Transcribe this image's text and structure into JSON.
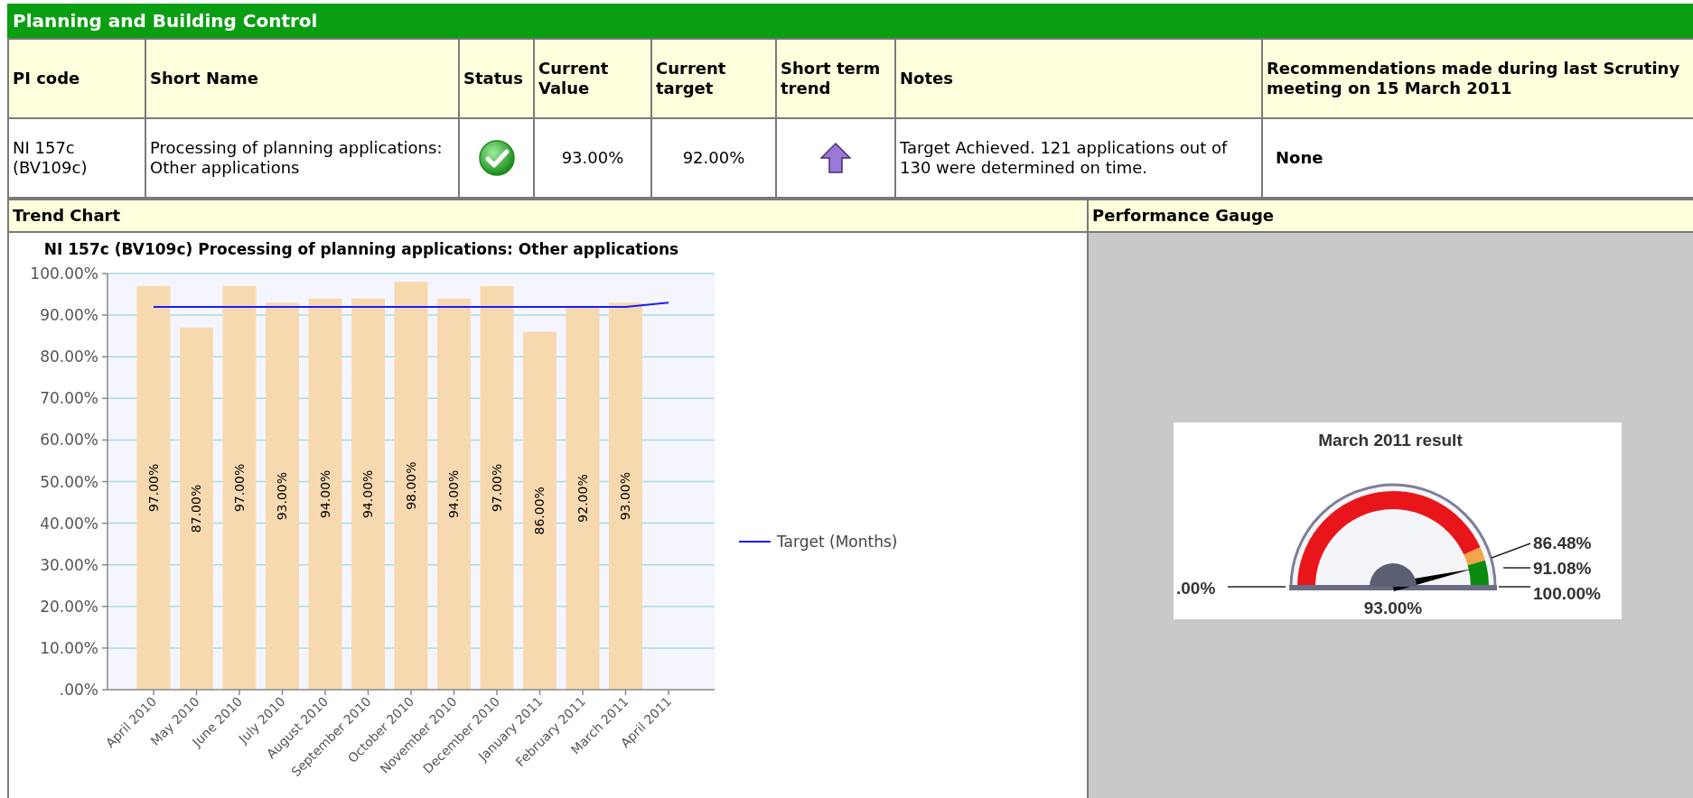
{
  "section": {
    "title": "Planning and Building Control"
  },
  "columns": [
    "PI code",
    "Short Name",
    "Status",
    "Current Value",
    "Current target",
    "Short term trend",
    "Notes",
    "Recommendations made during last Scrutiny meeting on 15 March 2011"
  ],
  "rows": [
    {
      "pi_code": "NI 157c (BV109c)",
      "short_name": "Processing of planning applications: Other applications",
      "target_met": true,
      "current_value": "93.00%",
      "current_target": "92.00%",
      "improving": true,
      "notes": "Target Achieved. 121 applications out of 130 were determined on time.",
      "recommendations": "None"
    }
  ],
  "trend_chart": {
    "heading": "Trend Chart",
    "chart_data": {
      "type": "bar",
      "title": "NI 157c (BV109c) Processing of planning applications: Other applications",
      "categories": [
        "April 2010",
        "May 2010",
        "June 2010",
        "July 2010",
        "August 2010",
        "September 2010",
        "October 2010",
        "November 2010",
        "December 2010",
        "January 2011",
        "February 2011",
        "March 2011",
        "April 2011"
      ],
      "series": [
        {
          "type": "bar",
          "color": "#f7d9b0",
          "values": [
            97,
            87,
            97,
            93,
            94,
            94,
            98,
            94,
            97,
            86,
            92,
            93,
            null
          ]
        },
        {
          "name": "Target (Months)",
          "type": "line",
          "color": "#1a1aff",
          "values": [
            92,
            92,
            92,
            92,
            92,
            92,
            92,
            92,
            92,
            92,
            92,
            92,
            93
          ]
        }
      ],
      "ylim": [
        0,
        100
      ],
      "grid": true,
      "yticks": [
        {
          "value": 0,
          "label": ".00%"
        },
        {
          "value": 10,
          "label": "10.00%"
        },
        {
          "value": 20,
          "label": "20.00%"
        },
        {
          "value": 30,
          "label": "30.00%"
        },
        {
          "value": 40,
          "label": "40.00%"
        },
        {
          "value": 50,
          "label": "50.00%"
        },
        {
          "value": 60,
          "label": "60.00%"
        },
        {
          "value": 70,
          "label": "70.00%"
        },
        {
          "value": 80,
          "label": "80.00%"
        },
        {
          "value": 90,
          "label": "90.00%"
        },
        {
          "value": 100,
          "label": "100.00%"
        }
      ],
      "value_labels": [
        "97.00%",
        "87.00%",
        "97.00%",
        "93.00%",
        "94.00%",
        "94.00%",
        "98.00%",
        "94.00%",
        "97.00%",
        "86.00%",
        "92.00%",
        "93.00%"
      ]
    }
  },
  "performance_gauge": {
    "heading": "Performance Gauge",
    "title": "March 2011 result",
    "reading": "93.00%",
    "scale_labels": [
      ".00%",
      "86.48%",
      "91.08%",
      "100.00%"
    ],
    "bands": [
      {
        "color": "#e8161a"
      },
      {
        "color": "#f2a448"
      },
      {
        "color": "#0a8a0e"
      }
    ]
  }
}
